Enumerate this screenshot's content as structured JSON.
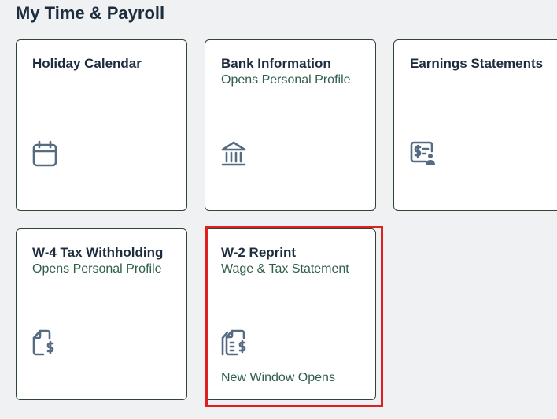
{
  "section": {
    "title": "My Time & Payroll"
  },
  "tiles": [
    {
      "title": "Holiday Calendar",
      "subtitle": "",
      "icon": "calendar-icon",
      "footer": ""
    },
    {
      "title": "Bank Information",
      "subtitle": "Opens Personal Profile",
      "icon": "bank-icon",
      "footer": ""
    },
    {
      "title": "Earnings Statements",
      "subtitle": "",
      "icon": "earnings-statement-icon",
      "footer": ""
    },
    {
      "title": "W-4 Tax Withholding",
      "subtitle": "Opens Personal Profile",
      "icon": "tax-document-icon",
      "footer": ""
    },
    {
      "title": "W-2 Reprint",
      "subtitle": "Wage & Tax Statement",
      "icon": "tax-statement-icon",
      "footer": "New Window Opens"
    }
  ],
  "colors": {
    "background": "#eff1f2",
    "tile_background": "#ffffff",
    "tile_border": "#314535",
    "title_text": "#1d2d3e",
    "subtitle_text": "#2f5f4b",
    "icon": "#556b82",
    "highlight": "#e01f1f"
  }
}
